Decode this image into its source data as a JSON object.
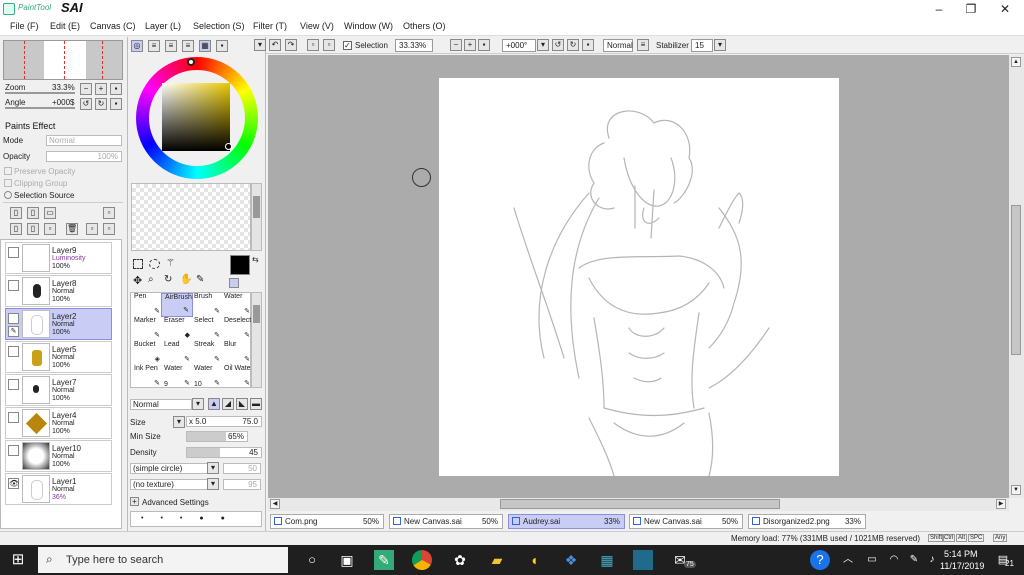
{
  "app": {
    "logo_text": "PaintTool",
    "logo_name": "SAI",
    "window_controls": [
      "–",
      "❐",
      "✕"
    ]
  },
  "menu": [
    {
      "label": "File (F)"
    },
    {
      "label": "Edit (E)"
    },
    {
      "label": "Canvas (C)"
    },
    {
      "label": "Layer (L)"
    },
    {
      "label": "Selection (S)"
    },
    {
      "label": "Filter (T)"
    },
    {
      "label": "View (V)"
    },
    {
      "label": "Window (W)"
    },
    {
      "label": "Others (O)"
    }
  ],
  "navigator": {
    "zoom_label": "Zoom",
    "zoom_value": "33.3%",
    "angle_label": "Angle",
    "angle_value": "+000$"
  },
  "paints_effect": {
    "header": "Paints Effect",
    "mode_label": "Mode",
    "mode_value": "Normal",
    "opacity_label": "Opacity",
    "opacity_value": "100%",
    "preserve_opacity": "Preserve Opacity",
    "clipping_group": "Clipping Group",
    "selection_source": "Selection Source"
  },
  "layers": [
    {
      "name": "Layer9",
      "mode": "Luminosity",
      "opacity": "100%",
      "selected": false
    },
    {
      "name": "Layer8",
      "mode": "Normal",
      "opacity": "100%",
      "selected": false
    },
    {
      "name": "Layer2",
      "mode": "Normal",
      "opacity": "100%",
      "selected": true
    },
    {
      "name": "Layer5",
      "mode": "Normal",
      "opacity": "100%",
      "selected": false
    },
    {
      "name": "Layer7",
      "mode": "Normal",
      "opacity": "100%",
      "selected": false
    },
    {
      "name": "Layer4",
      "mode": "Normal",
      "opacity": "100%",
      "selected": false
    },
    {
      "name": "Layer10",
      "mode": "Normal",
      "opacity": "100%",
      "selected": false
    },
    {
      "name": "Layer1",
      "mode": "Normal",
      "opacity": "36%",
      "selected": false
    }
  ],
  "tools": [
    {
      "label": "Pen",
      "num": ""
    },
    {
      "label": "AirBrush",
      "num": ""
    },
    {
      "label": "Brush",
      "num": ""
    },
    {
      "label": "Water",
      "num": ""
    },
    {
      "label": "Marker",
      "num": ""
    },
    {
      "label": "Eraser",
      "num": ""
    },
    {
      "label": "Select",
      "num": ""
    },
    {
      "label": "Deselect",
      "num": ""
    },
    {
      "label": "Bucket",
      "num": ""
    },
    {
      "label": "Lead",
      "num": ""
    },
    {
      "label": "Streak",
      "num": ""
    },
    {
      "label": "Blur",
      "num": ""
    },
    {
      "label": "Ink Pen",
      "num": ""
    },
    {
      "label": "Water",
      "num": "9"
    },
    {
      "label": "Water",
      "num": "10"
    },
    {
      "label": "Oil Wate",
      "num": ""
    }
  ],
  "brush": {
    "blend_mode": "Normal",
    "size_label": "Size",
    "size_mult": "x 5.0",
    "size_value": "75.0",
    "min_size_label": "Min Size",
    "min_size_value": "65%",
    "min_size_fraction": 0.65,
    "density_label": "Density",
    "density_value": "45",
    "density_fraction": 0.45,
    "shape": "(simple circle)",
    "shape_value": "50",
    "texture": "(no texture)",
    "texture_value": "95",
    "advanced": "Advanced Settings"
  },
  "toolbar": {
    "selection_label": "Selection",
    "zoom": "33.33%",
    "angle": "+000°",
    "blend": "Normal",
    "stabilizer_label": "Stabilizer",
    "stabilizer_value": "15"
  },
  "tabs": [
    {
      "name": "Com.png",
      "zoom": "50%",
      "selected": false
    },
    {
      "name": "New Canvas.sai",
      "zoom": "50%",
      "selected": false
    },
    {
      "name": "Audrey.sai",
      "zoom": "33%",
      "selected": true
    },
    {
      "name": "New Canvas.sai",
      "zoom": "50%",
      "selected": false
    },
    {
      "name": "Disorganized2.png",
      "zoom": "33%",
      "selected": false
    }
  ],
  "status": {
    "memory": "Memory load: 77% (331MB used / 1021MB reserved)",
    "keys": [
      "Shift",
      "Ctrl",
      "Alt",
      "SPC",
      "Any"
    ]
  },
  "taskbar": {
    "search_placeholder": "Type here to search",
    "time": "5:14 PM",
    "date": "11/17/2019",
    "mail_badge": "75",
    "notification_count": "21"
  },
  "colors": {
    "selection_highlight": "#c9cdf5",
    "canvas_bg": "#ababab",
    "taskbar": "#1f1f1f",
    "main_color": "#000000"
  }
}
